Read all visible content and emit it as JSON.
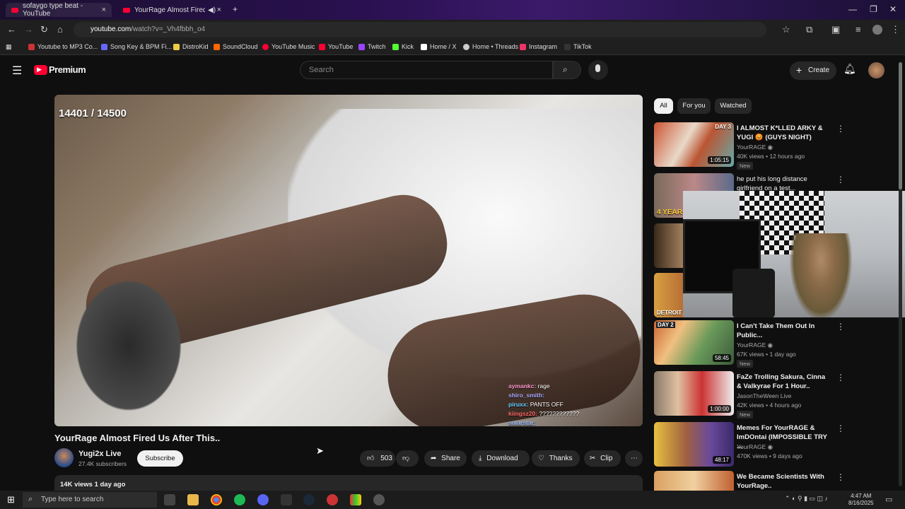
{
  "browser": {
    "tabs": [
      {
        "title": "sofaygo type beat - YouTube",
        "active": true
      },
      {
        "title": "YourRage Almost Fired Us A",
        "active": false
      }
    ],
    "url_host": "youtube.com",
    "url_path": "/watch?v=_Vh4fbbh_o4",
    "bookmarks": [
      "Youtube to MP3 Co...",
      "Song Key & BPM Fi...",
      "DistroKid",
      "SoundCloud",
      "YouTube Music",
      "YouTube",
      "Twitch",
      "Kick",
      "Home / X",
      "Home • Threads",
      "Instagram",
      "TikTok"
    ]
  },
  "masthead": {
    "logo": "Premium",
    "search_placeholder": "Search",
    "create_label": "Create"
  },
  "player": {
    "counter": "14401 / 14500",
    "chat": [
      {
        "user": "aymankc:",
        "msg": "rage"
      },
      {
        "user": "shiro_smith:",
        "msg": ""
      },
      {
        "user": "piruxx:",
        "msg": "PANTS OFF"
      },
      {
        "user": "kiingsz20:",
        "msg": "????????????"
      },
      {
        "user": "solarstar:",
        "msg": ""
      }
    ]
  },
  "video": {
    "title": "YourRage Almost Fired Us After This..",
    "channel": "Yugi2x Live",
    "subscribers": "27.4K subscribers",
    "subscribe_label": "Subscribe",
    "likes": "503",
    "share_label": "Share",
    "download_label": "Download",
    "thanks_label": "Thanks",
    "clip_label": "Clip",
    "views_date": "14K views  1 day ago"
  },
  "sidebar": {
    "chips": [
      "All",
      "For you",
      "Watched"
    ],
    "recs": [
      {
        "title": "I ALMOST K*LLED ARKY & YUGI 😡 (GUYS NIGHT)",
        "channel": "YourRAGE",
        "meta": "40K views • 12 hours ago",
        "badge": "New",
        "duration": "1:05:15",
        "thumb_text": "DAY 3"
      },
      {
        "title": "he put his long distance girlfriend on a test...",
        "channel": "",
        "meta": "",
        "badge": "",
        "duration": "",
        "thumb_text": "4 YEAR"
      },
      {
        "title": "",
        "channel": "",
        "meta": "",
        "badge": "",
        "duration": "",
        "thumb_text": ""
      },
      {
        "title": "",
        "channel": "",
        "meta": "",
        "badge": "",
        "duration": "",
        "thumb_text": "DETROIT"
      },
      {
        "title": "I Can't Take Them Out In Public...",
        "channel": "YourRAGE",
        "meta": "67K views • 1 day ago",
        "badge": "New",
        "duration": "58:45",
        "thumb_text": "DAY 2"
      },
      {
        "title": "FaZe Trolling Sakura, Cinna & Valkyrae For 1 Hour..",
        "channel": "JasonTheWeen Live",
        "meta": "42K views • 4 hours ago",
        "badge": "New",
        "duration": "1:00:00",
        "thumb_text": ""
      },
      {
        "title": "Memes For YourRAGE & ImDOntai (IMPOSSIBLE TRY ...",
        "channel": "YourRAGE",
        "meta": "470K views • 9 days ago",
        "badge": "",
        "duration": "48:17",
        "thumb_text": ""
      },
      {
        "title": "We Became Scientists With YourRage..",
        "channel": "",
        "meta": "",
        "badge": "",
        "duration": "",
        "thumb_text": ""
      }
    ]
  },
  "taskbar": {
    "search_placeholder": "Type here to search",
    "time": "4:47 AM",
    "date": "8/16/2025"
  },
  "colors": {
    "brand": "#ff0033",
    "bg": "#0f0f0f"
  }
}
